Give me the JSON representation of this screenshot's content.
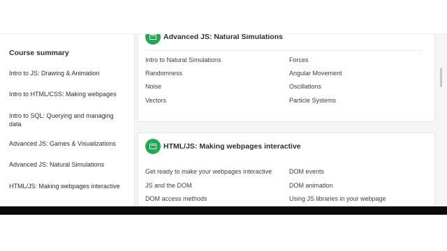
{
  "sidebar": {
    "title": "Course summary",
    "items": [
      {
        "label": "Intro to JS: Drawing & Animation"
      },
      {
        "label": "Intro to HTML/CSS: Making webpages"
      },
      {
        "label": "Intro to SQL: Querying and managing data"
      },
      {
        "label": "Advanced JS: Games & Visualizations"
      },
      {
        "label": "Advanced JS: Natural Simulations"
      },
      {
        "label": "HTML/JS: Making webpages interactive"
      }
    ]
  },
  "cards": [
    {
      "title": "Advanced JS: Natural Simulations",
      "icon": "course-icon",
      "accent": "#1fab54",
      "lessons_left": [
        "Intro to Natural Simulations",
        "Randomness",
        "Noise",
        "Vectors"
      ],
      "lessons_right": [
        "Forces",
        "Angular Movement",
        "Oscillations",
        "Particle Systems"
      ]
    },
    {
      "title": "HTML/JS: Making webpages interactive",
      "icon": "course-icon",
      "accent": "#1fab54",
      "lessons_left": [
        "Get ready to make your webpages interactive",
        "JS and the DOM",
        "DOM access methods"
      ],
      "lessons_right": [
        "DOM events",
        "DOM animation",
        "Using JS libraries in your webpage"
      ]
    }
  ]
}
